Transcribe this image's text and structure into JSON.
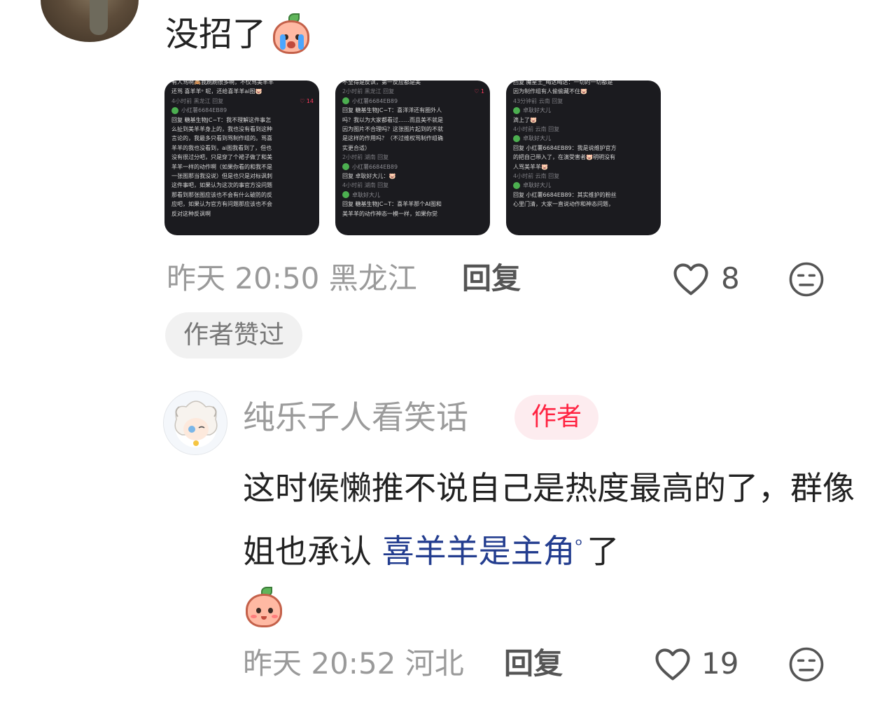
{
  "top_comment": {
    "text": "没招了",
    "emoji": "crying-peach-icon",
    "images": [
      {
        "lines": [
          {
            "t": "有人骂啊🙈我刷刷很多啊，不仅骂美羊羊",
            "c": "text"
          },
          {
            "t": "还骂 喜羊羊ᵒ 呢，还给喜羊羊ai图🐷",
            "c": "text"
          },
          {
            "t": "4小时前 黑龙江   回复",
            "c": "meta",
            "likes": "14"
          },
          {
            "t": "小红薯6684EB89",
            "c": "name"
          },
          {
            "t": "回复 糖基生物JC−T：我不理解这件事怎",
            "c": "text"
          },
          {
            "t": "么扯到美羊羊身上的，我也没有看到这种",
            "c": "text"
          },
          {
            "t": "言论的，我最多只看到骂制作组的。骂喜",
            "c": "text"
          },
          {
            "t": "羊羊的我也没看到，ai图我看到了，但也",
            "c": "text"
          },
          {
            "t": "没有很过分吧，只是穿了个裙子做了和美",
            "c": "text"
          },
          {
            "t": "羊羊一样的动作啊（如果你看的和我不是",
            "c": "text"
          },
          {
            "t": "一张图那当我没说）但是也只是对标讽刺",
            "c": "text"
          },
          {
            "t": "这件事吧，如果认为这次的事官方没问题",
            "c": "text"
          },
          {
            "t": "那看到那张图应该也不会有什么破防的反",
            "c": "text"
          },
          {
            "t": "应吧，如果认为官方有问题那应该也不会",
            "c": "text"
          },
          {
            "t": "反对这种反讽啊",
            "c": "text"
          }
        ]
      },
      {
        "lines": [
          {
            "t": "不至得是反讽，第一反应都是美",
            "c": "text"
          },
          {
            "t": "2小时前 黑龙江   回复",
            "c": "meta",
            "likes": "1"
          },
          {
            "t": "小红薯6684EB89",
            "c": "name"
          },
          {
            "t": "回复 糖基生物JC−T：喜洋洋还有圈外人",
            "c": "text"
          },
          {
            "t": "吗？我以为大家都看过……而且美不就是",
            "c": "text"
          },
          {
            "t": "因为图片不合理吗？这张图片起到的不就",
            "c": "text"
          },
          {
            "t": "是这样的作用吗？（不过维权骂制作组确",
            "c": "text"
          },
          {
            "t": "实更合适）",
            "c": "text"
          },
          {
            "t": "2小时前 湖南   回复",
            "c": "meta"
          },
          {
            "t": "小红薯6684EB89",
            "c": "name"
          },
          {
            "t": "回复 卓耿好大儿：🐷",
            "c": "text"
          },
          {
            "t": "4小时前 湖南   回复",
            "c": "meta"
          },
          {
            "t": "卓耿好大儿",
            "c": "name"
          },
          {
            "t": "回复 糖基生物JC−T：喜羊羊那个AI图和",
            "c": "text"
          },
          {
            "t": "美羊羊的动作神态一模一样，如果你觉",
            "c": "text"
          }
        ]
      },
      {
        "lines": [
          {
            "t": "回复 魔星王_晦达晦达：一切的一切都是",
            "c": "text"
          },
          {
            "t": "因为制作组有人偷偷藏不住🐷",
            "c": "text"
          },
          {
            "t": "43分钟前 云南   回复",
            "c": "meta"
          },
          {
            "t": "卓耿好大儿",
            "c": "name"
          },
          {
            "t": "滴上了🐷",
            "c": "text"
          },
          {
            "t": "4小时前 云南   回复",
            "c": "meta"
          },
          {
            "t": "卓耿好大儿",
            "c": "name"
          },
          {
            "t": "回复 小红薯6684EB89：我是说维护官方",
            "c": "text"
          },
          {
            "t": "的把自己带入了，在演受害者🐷明明没有",
            "c": "text"
          },
          {
            "t": "人骂美羊羊🐷",
            "c": "text"
          },
          {
            "t": "4小时前 云南   回复",
            "c": "meta"
          },
          {
            "t": "卓耿好大儿",
            "c": "name"
          },
          {
            "t": "回复 小红薯6684EB89：其实维护的粉丝",
            "c": "text"
          },
          {
            "t": "心里门清，大家一直说动作和神态问题，",
            "c": "text"
          }
        ]
      }
    ],
    "meta": "昨天 20:50 黑龙江",
    "reply_label": "回复",
    "likes": "8",
    "author_liked_label": "作者赞过"
  },
  "reply_comment": {
    "username": "纯乐子人看笑话",
    "author_badge": "作者",
    "text_part1": "这时候懒推不说自己是热度最高的了，群像姐也承认",
    "topic_link": "喜羊羊是主角",
    "text_part2": "了",
    "emoji": "peach-smile-icon",
    "meta": "昨天 20:52 河北",
    "reply_label": "回复",
    "likes": "19"
  },
  "colors": {
    "accent_red": "#ff2442",
    "link_blue": "#233d8f",
    "meta_gray": "#9a9a9a"
  }
}
